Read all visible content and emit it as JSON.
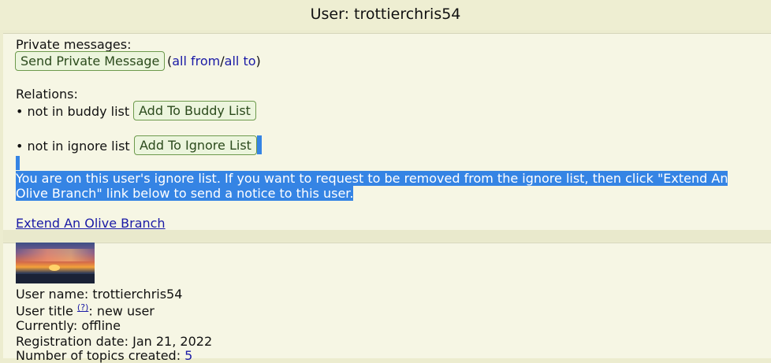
{
  "page": {
    "title": "User: trottierchris54"
  },
  "messages": {
    "heading": "Private messages:",
    "send_button": "Send Private Message",
    "open_paren": "(",
    "all_from": "all from",
    "slash": "/",
    "all_to": "all to",
    "close_paren": ")"
  },
  "relations": {
    "heading": "Relations:",
    "buddy_status": "• not in buddy list",
    "buddy_button": "Add To Buddy List",
    "ignore_status": "• not in ignore list",
    "ignore_button": "Add To Ignore List"
  },
  "notice": {
    "line1": "You are on this user's ignore list. If you want to request to be removed from the ignore list, then click \"Extend An",
    "line2": "Olive Branch\" link below to send a notice to this user.",
    "olive_branch_link": "Extend An Olive Branch"
  },
  "profile": {
    "avatar_alt": "sunset avatar",
    "user_name": "User name: trottierchris54",
    "user_title_label": "User title ",
    "user_title_help": "(?)",
    "user_title_value": ": new user",
    "currently": "Currently: offline",
    "registration": "Registration date: Jan 21, 2022",
    "topics_label": "Number of topics created: ",
    "topics_count": "5"
  },
  "colors": {
    "background": "#ececcf",
    "panel": "#f6f6e4",
    "button_border": "#6d9a4c",
    "button_bg": "#ecf5dd",
    "link": "#1a1aa6",
    "selection": "#3584e4"
  }
}
